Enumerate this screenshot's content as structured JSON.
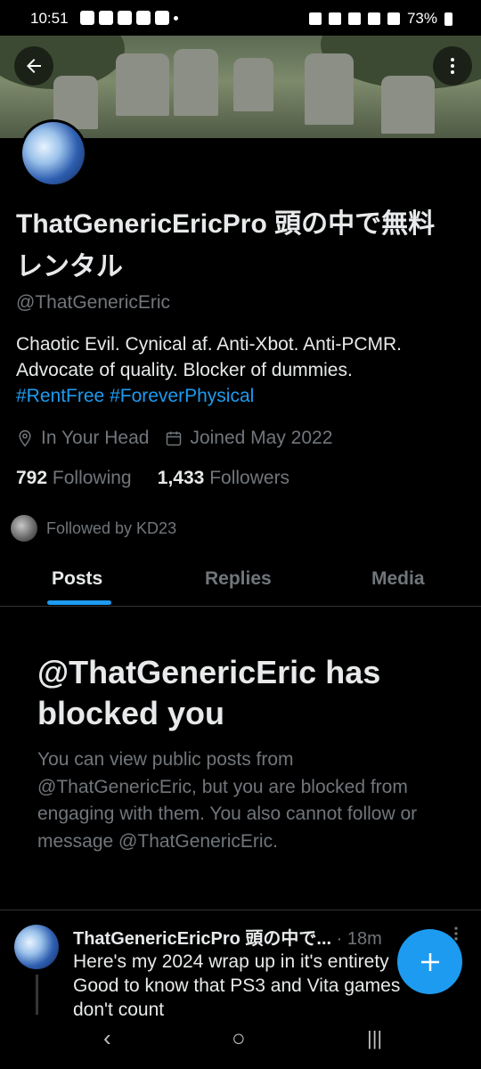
{
  "status_bar": {
    "time": "10:51",
    "battery": "73%"
  },
  "header": {
    "back_icon": "arrow-left-icon",
    "more_icon": "more-vertical-icon"
  },
  "profile": {
    "display_name": "ThatGenericEricPro 頭の中で無料レンタル",
    "handle": "@ThatGenericEric",
    "bio_text": "Chaotic Evil. Cynical af. Anti-Xbot. Anti-PCMR. Advocate of quality. Blocker of dummies.",
    "bio_hashtags": [
      "#RentFree",
      "#ForeverPhysical"
    ],
    "location": "In Your Head",
    "joined": "Joined May 2022",
    "following_count": "792",
    "following_label": "Following",
    "followers_count": "1,433",
    "followers_label": "Followers",
    "followed_by": "Followed by KD23"
  },
  "tabs": [
    {
      "label": "Posts"
    },
    {
      "label": "Replies"
    },
    {
      "label": "Media"
    }
  ],
  "blocked": {
    "title": "@ThatGenericEric has blocked you",
    "description": "You can view public posts from @ThatGenericEric, but you are blocked from engaging with them. You also cannot follow or message @ThatGenericEric."
  },
  "post": {
    "author": "ThatGenericEricPro 頭の中で...",
    "time": "· 18m",
    "text": "Here's my 2024 wrap up in it's entirety\nGood to know that PS3 and Vita games\ndon't count"
  },
  "fab_icon": "plus-icon",
  "nav": {
    "back": "‹",
    "home": "○",
    "recents": "|||"
  },
  "colors": {
    "accent": "#1d9bf0",
    "background": "#000000",
    "muted_text": "#71767b"
  }
}
